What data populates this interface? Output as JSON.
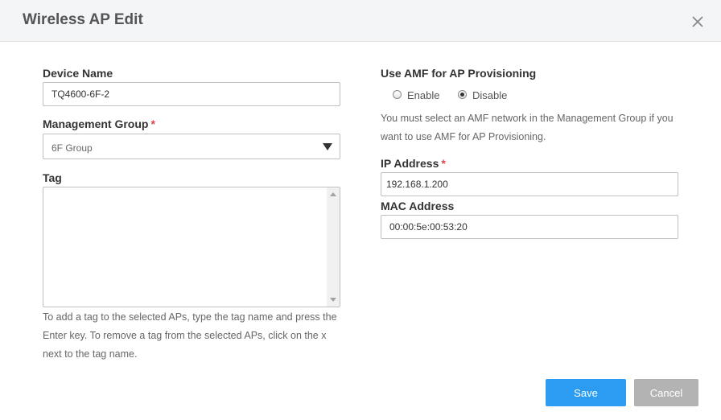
{
  "dialog": {
    "title": "Wireless AP Edit"
  },
  "form": {
    "device_name": {
      "label": "Device Name",
      "value": "TQ4600-6F-2"
    },
    "management_group": {
      "label": "Management Group",
      "required_mark": "*",
      "selected": "6F Group"
    },
    "tag": {
      "label": "Tag",
      "value": "",
      "help": "To add a tag to the selected APs, type the tag name and press the Enter key. To remove a tag from the selected APs, click on the x next to the tag name."
    },
    "amf": {
      "label": "Use AMF for AP Provisioning",
      "options": [
        {
          "label": "Enable",
          "checked": false
        },
        {
          "label": "Disable",
          "checked": true
        }
      ],
      "help": "You must select an AMF network in the Management Group if you want to use AMF for AP Provisioning."
    },
    "ip_address": {
      "label": "IP Address",
      "required_mark": "*",
      "value": "192.168.1.200"
    },
    "mac_address": {
      "label": "MAC Address",
      "value": "00:00:5e:00:53:20"
    }
  },
  "buttons": {
    "save": "Save",
    "cancel": "Cancel"
  },
  "icons": {
    "close": "close-icon",
    "dropdown": "caret-down-icon"
  },
  "colors": {
    "primary": "#2b9cf2",
    "secondary": "#b3b3b3",
    "required": "#e0454f",
    "header_bg": "#f4f5f7"
  }
}
